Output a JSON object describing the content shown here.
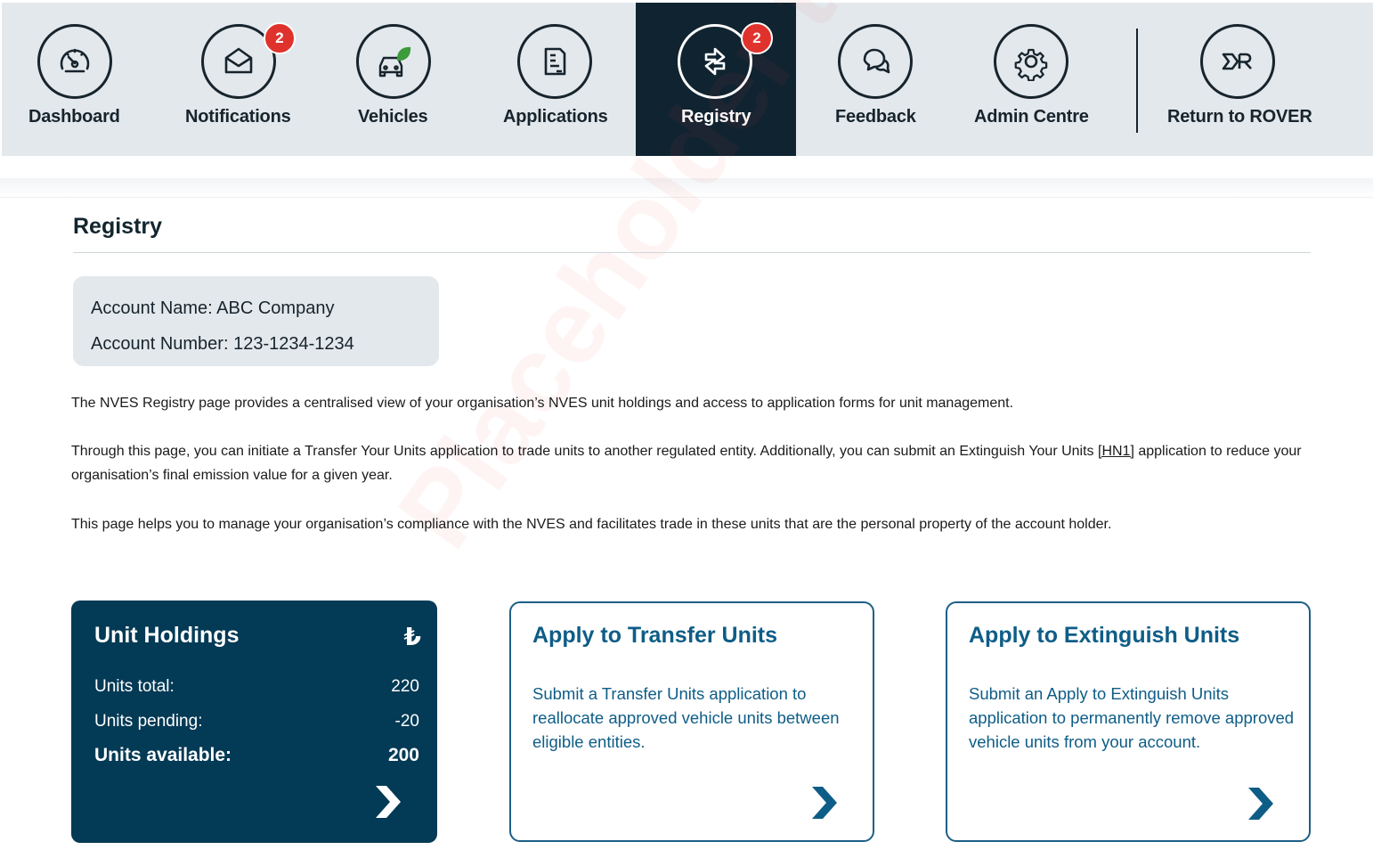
{
  "nav": {
    "items": [
      {
        "label": "Dashboard",
        "icon": "speedometer-icon"
      },
      {
        "label": "Notifications",
        "icon": "envelope-icon",
        "badge": "2"
      },
      {
        "label": "Vehicles",
        "icon": "eco-vehicle-icon"
      },
      {
        "label": "Applications",
        "icon": "document-icon"
      },
      {
        "label": "Registry",
        "icon": "transfer-arrows-icon",
        "badge": "2",
        "active": true
      },
      {
        "label": "Feedback",
        "icon": "chat-bubbles-icon"
      },
      {
        "label": "Admin Centre",
        "icon": "gear-icon"
      },
      {
        "label": "Return to ROVER",
        "icon": "rover-logo-icon"
      }
    ]
  },
  "page": {
    "title": "Registry",
    "account_name": "Account Name: ABC Company",
    "account_number": "Account Number: 123-1234-1234",
    "para1": "The NVES Registry page provides a centralised view of your organisation’s NVES unit holdings and access to application forms for unit management.",
    "para2_before": "Through this page, you can initiate a Transfer Your Units application to trade units to another regulated entity. Additionally, you can submit an Extinguish Your Units ",
    "para2_link": "[HN1]",
    "para2_after": " application to reduce your organisation’s final emission value for a given year.",
    "para3": "This page helps you to manage your organisation’s compliance with the NVES and facilitates trade in these units that are the personal property of the account holder."
  },
  "holdings": {
    "title": "Unit Holdings",
    "icon_glyph": "₺",
    "total_label": "Units total:",
    "total_value": "220",
    "pending_label": "Units pending:",
    "pending_value": "-20",
    "available_label": "Units available:",
    "available_value": "200"
  },
  "transfer": {
    "title": "Apply to Transfer Units",
    "desc": "Submit a Transfer Units application to reallocate approved vehicle units between eligible entities."
  },
  "extinguish": {
    "title": "Apply to Extinguish Units",
    "desc": "Submit an Apply to Extinguish Units application to permanently remove approved vehicle units from your account."
  },
  "watermark": "Placeholder text",
  "colors": {
    "nav_bg": "#e3e8ec",
    "nav_active": "#0f2430",
    "badge": "#e0322c",
    "dark_card": "#033a55",
    "accent_blue": "#0e5d87"
  }
}
